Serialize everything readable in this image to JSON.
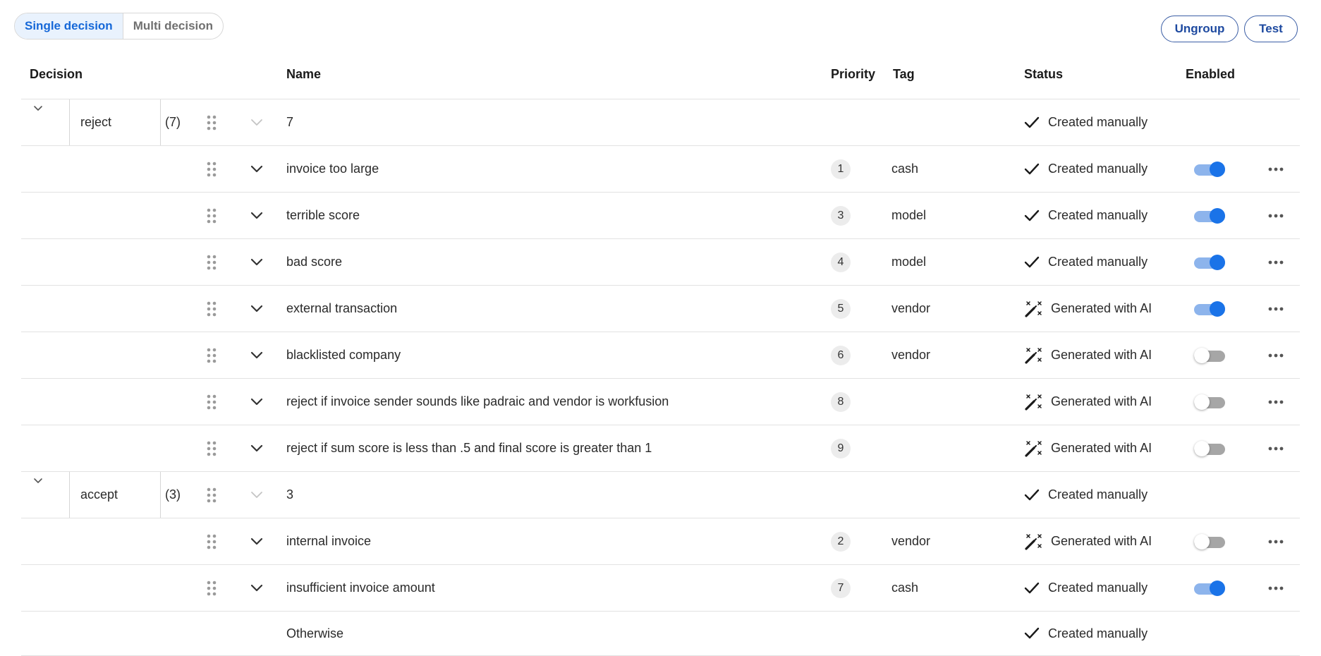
{
  "segmented": {
    "single": "Single decision",
    "multi": "Multi decision"
  },
  "actions": {
    "ungroup": "Ungroup",
    "test": "Test"
  },
  "headers": {
    "decision": "Decision",
    "name": "Name",
    "priority": "Priority",
    "tag": "Tag",
    "status": "Status",
    "enabled": "Enabled"
  },
  "groups": [
    {
      "label": "reject",
      "count": "(7)",
      "name": "7",
      "status": "Created manually"
    },
    {
      "label": "accept",
      "count": "(3)",
      "name": "3",
      "status": "Created manually"
    }
  ],
  "rules": [
    {
      "name": "invoice too large",
      "priority": "1",
      "tag": "cash",
      "status": "Created manually",
      "status_icon": "check-icon",
      "enabled": true
    },
    {
      "name": "terrible score",
      "priority": "3",
      "tag": "model",
      "status": "Created manually",
      "status_icon": "check-icon",
      "enabled": true
    },
    {
      "name": "bad score",
      "priority": "4",
      "tag": "model",
      "status": "Created manually",
      "status_icon": "check-icon",
      "enabled": true
    },
    {
      "name": "external transaction",
      "priority": "5",
      "tag": "vendor",
      "status": "Generated with AI",
      "status_icon": "magic-wand-icon",
      "enabled": true
    },
    {
      "name": "blacklisted company",
      "priority": "6",
      "tag": "vendor",
      "status": "Generated with AI",
      "status_icon": "magic-wand-icon",
      "enabled": false
    },
    {
      "name": "reject if invoice sender sounds like padraic and vendor is workfusion",
      "priority": "8",
      "tag": "",
      "status": "Generated with AI",
      "status_icon": "magic-wand-icon",
      "enabled": false
    },
    {
      "name": "reject if sum score is less than .5 and final score is greater than 1",
      "priority": "9",
      "tag": "",
      "status": "Generated with AI",
      "status_icon": "magic-wand-icon",
      "enabled": false
    },
    {
      "name": "internal invoice",
      "priority": "2",
      "tag": "vendor",
      "status": "Generated with AI",
      "status_icon": "magic-wand-icon",
      "enabled": false
    },
    {
      "name": "insufficient invoice amount",
      "priority": "7",
      "tag": "cash",
      "status": "Created manually",
      "status_icon": "check-icon",
      "enabled": true
    }
  ],
  "otherwise": {
    "name": "Otherwise",
    "status": "Created manually"
  },
  "colors": {
    "accent": "#1a73e8",
    "toggle_on_track": "#8db4ec",
    "toggle_off_track": "#a6a6a6",
    "segment_active_bg": "#e9f2fd"
  }
}
